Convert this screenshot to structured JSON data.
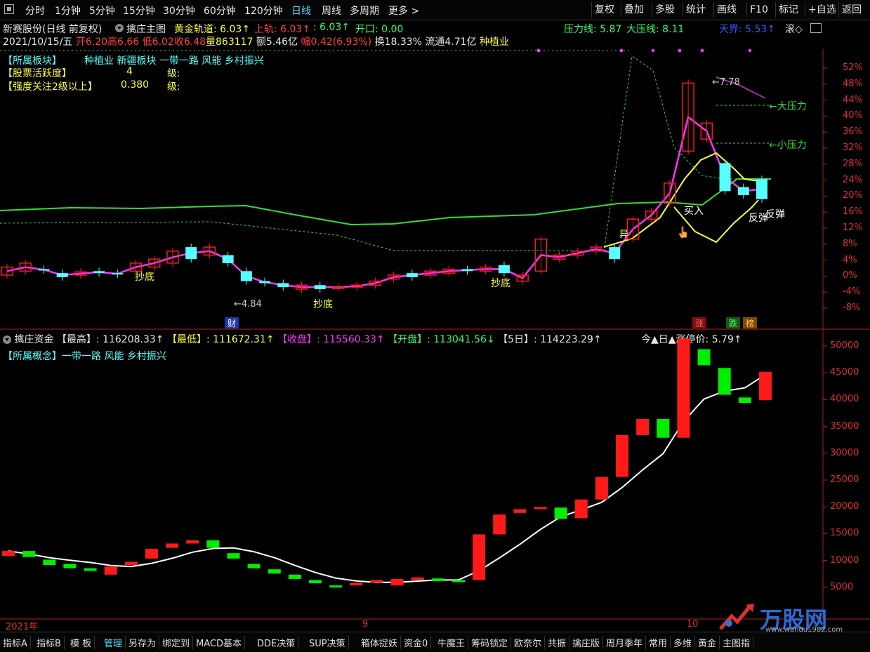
{
  "toolbar": {
    "periods": [
      "分时",
      "1分钟",
      "5分钟",
      "15分钟",
      "30分钟",
      "60分钟",
      "120分钟",
      "日线",
      "周线",
      "多周期",
      "更多 >"
    ],
    "active_period": "日线",
    "right_buttons": [
      "复权",
      "叠加",
      "多股",
      "统计",
      "画线",
      "F10",
      "标记",
      "+自选",
      "返回"
    ]
  },
  "header1": {
    "stock": "新赛股份(日线 前复权)",
    "indicator": "擒庄主图",
    "gold_track": "黄金轨道: 6.03↑",
    "upper_track": "上轨: 6.03↑",
    "mid": ": 6.03↑",
    "open_label": "开口: 0.00",
    "pressure": "压力线: 5.87",
    "big_pressure": "大压线: 8.11",
    "tianjie": "天界: 5.53↑",
    "collapse": "滚◇"
  },
  "header2": {
    "date": "2021/10/15/五",
    "open": "开6.20",
    "high": "高6.66",
    "low": "低6.02",
    "close": "收6.48",
    "vol": "量863117",
    "amt": "额5.46亿",
    "amp": "幅0.42(6.93%)",
    "turnover": "换18.33%",
    "float": "流通4.71亿",
    "sector": "种植业"
  },
  "info": {
    "sector_label": "【所属板块】",
    "sector_value": "种植业 新疆板块 一带一路 风能 乡村振兴",
    "activity_label": "【股票活跃度】",
    "activity_value": "4",
    "activity_unit": "级:",
    "focus_label": "【强度关注2级以上】",
    "focus_value": "0.380",
    "focus_unit": "级:"
  },
  "annotations1": {
    "buy": "买入",
    "rebound1": "反弹",
    "rebound2": "反弹",
    "chaodi1": "抄底",
    "chaodi2": "抄底",
    "chaodi3": "抄底",
    "yi": "异",
    "low_mark": "←4.84",
    "high_mark": "←7.78",
    "big_pressure_mark": "←大压力",
    "small_pressure_mark": "←小压力",
    "cai": "财",
    "zhang": "涨",
    "die": "跌",
    "bang": "榜"
  },
  "y_axis1": [
    "52%",
    "48%",
    "44%",
    "40%",
    "36%",
    "32%",
    "28%",
    "24%",
    "20%",
    "16%",
    "12%",
    "8%",
    "4%",
    "0%",
    "-4%",
    "-8%"
  ],
  "header3": {
    "name": "擒庄资金",
    "high": "【最高】: 116208.33↑",
    "low": "【最低】: 111672.31↑",
    "close": "【收盘】: 115560.33↑",
    "open": "【开盘】: 113041.56↓",
    "five": "【5日】: 114223.29↑",
    "limit": "今▲日▲涨停价: 5.79↑",
    "concept": "【所属概念】一带一路 风能 乡村振兴"
  },
  "y_axis2": [
    "50000",
    "45000",
    "40000",
    "35000",
    "30000",
    "25000",
    "20000",
    "15000",
    "10000",
    "5000"
  ],
  "date_axis": [
    "2021年",
    "9",
    "10"
  ],
  "watermark": "万股网",
  "watermark_url": "www.wangu1982.com",
  "bottom_tabs": [
    "指标A",
    "指标B",
    "模 板",
    "管理",
    "另存为",
    "绑定到",
    "MACD基本",
    "DDE决策",
    "SUP决策",
    "箱体捉妖",
    "资金0",
    "牛魔王",
    "筹码锁定",
    "欧奈尔",
    "共振",
    "擒庄版",
    "周月季年",
    "常用",
    "多维",
    "黄金",
    "主图指"
  ],
  "colors": {
    "up": "#ff1a1a",
    "down_cyan": "#55ffff",
    "down_green": "#00ee00",
    "pink": "#ff33ff",
    "yellow": "#ffff33",
    "green_line": "#33dd33",
    "axis_red": "#e03030"
  },
  "chart_data": [
    {
      "type": "candlestick",
      "title": "擒庄主图",
      "ylabel": "%",
      "ylim": [
        -10,
        54
      ],
      "candles": [
        {
          "o": 0,
          "c": 2
        },
        {
          "o": 1,
          "c": 3
        },
        {
          "o": 1.5,
          "c": 1.2
        },
        {
          "o": 0.5,
          "c": -0.5
        },
        {
          "o": 0,
          "c": 0.8
        },
        {
          "o": 1,
          "c": 0.5
        },
        {
          "o": 0.5,
          "c": 0.2
        },
        {
          "o": 1,
          "c": 3
        },
        {
          "o": 2,
          "c": 4
        },
        {
          "o": 3,
          "c": 6
        },
        {
          "o": 7,
          "c": 4
        },
        {
          "o": 5,
          "c": 7
        },
        {
          "o": 5,
          "c": 3
        },
        {
          "o": 1,
          "c": -1.5
        },
        {
          "o": -1.5,
          "c": -2
        },
        {
          "o": -2,
          "c": -3
        },
        {
          "o": -3.5,
          "c": -2.5
        },
        {
          "o": -2.5,
          "c": -3.5
        },
        {
          "o": -3,
          "c": -3
        },
        {
          "o": -3,
          "c": -2.5
        },
        {
          "o": -2.5,
          "c": -1.5
        },
        {
          "o": -1,
          "c": 0
        },
        {
          "o": 0.5,
          "c": -0.5
        },
        {
          "o": 0,
          "c": 1
        },
        {
          "o": 0.5,
          "c": 1.5
        },
        {
          "o": 1.5,
          "c": 1
        },
        {
          "o": 1,
          "c": 2
        },
        {
          "o": 2.5,
          "c": 0.5
        },
        {
          "o": -1.5,
          "c": 0
        },
        {
          "o": 1,
          "c": 9
        },
        {
          "o": 4,
          "c": 5
        },
        {
          "o": 5,
          "c": 6
        },
        {
          "o": 6,
          "c": 7
        },
        {
          "o": 7,
          "c": 4
        },
        {
          "o": 9,
          "c": 14
        },
        {
          "o": 14,
          "c": 16
        },
        {
          "o": 18,
          "c": 23
        },
        {
          "o": 31,
          "c": 48
        },
        {
          "o": 34,
          "c": 38
        },
        {
          "o": 28,
          "c": 21
        },
        {
          "o": 22,
          "c": 20
        },
        {
          "o": 24,
          "c": 19
        }
      ]
    },
    {
      "type": "candlestick",
      "title": "擒庄资金",
      "ylim": [
        0,
        52000
      ],
      "candles": [
        {
          "o": 11500,
          "c": 12400
        },
        {
          "o": 12400,
          "c": 11300
        },
        {
          "o": 10800,
          "c": 9800
        },
        {
          "o": 10000,
          "c": 9200
        },
        {
          "o": 9200,
          "c": 8700
        },
        {
          "o": 8000,
          "c": 9500
        },
        {
          "o": 9800,
          "c": 10400
        },
        {
          "o": 11000,
          "c": 12800
        },
        {
          "o": 13000,
          "c": 13800
        },
        {
          "o": 13800,
          "c": 14400
        },
        {
          "o": 14400,
          "c": 13000
        },
        {
          "o": 12000,
          "c": 11000
        },
        {
          "o": 10000,
          "c": 9200
        },
        {
          "o": 9000,
          "c": 8200
        },
        {
          "o": 8000,
          "c": 7200
        },
        {
          "o": 7000,
          "c": 6400
        },
        {
          "o": 6000,
          "c": 5800
        },
        {
          "o": 6000,
          "c": 6500
        },
        {
          "o": 6500,
          "c": 7000
        },
        {
          "o": 6000,
          "c": 7200
        },
        {
          "o": 7000,
          "c": 7500
        },
        {
          "o": 7300,
          "c": 6800
        },
        {
          "o": 7000,
          "c": 6600
        },
        {
          "o": 7000,
          "c": 15500
        },
        {
          "o": 15500,
          "c": 19200
        },
        {
          "o": 19500,
          "c": 20200
        },
        {
          "o": 20200,
          "c": 20600
        },
        {
          "o": 20500,
          "c": 18400
        },
        {
          "o": 18500,
          "c": 22000
        },
        {
          "o": 22000,
          "c": 26200
        },
        {
          "o": 26200,
          "c": 34000
        },
        {
          "o": 34000,
          "c": 37000
        },
        {
          "o": 37000,
          "c": 33500
        },
        {
          "o": 33500,
          "c": 52000
        },
        {
          "o": 50000,
          "c": 47000
        },
        {
          "o": 46500,
          "c": 41500
        },
        {
          "o": 41000,
          "c": 40000
        },
        {
          "o": 40500,
          "c": 45800
        }
      ]
    }
  ]
}
